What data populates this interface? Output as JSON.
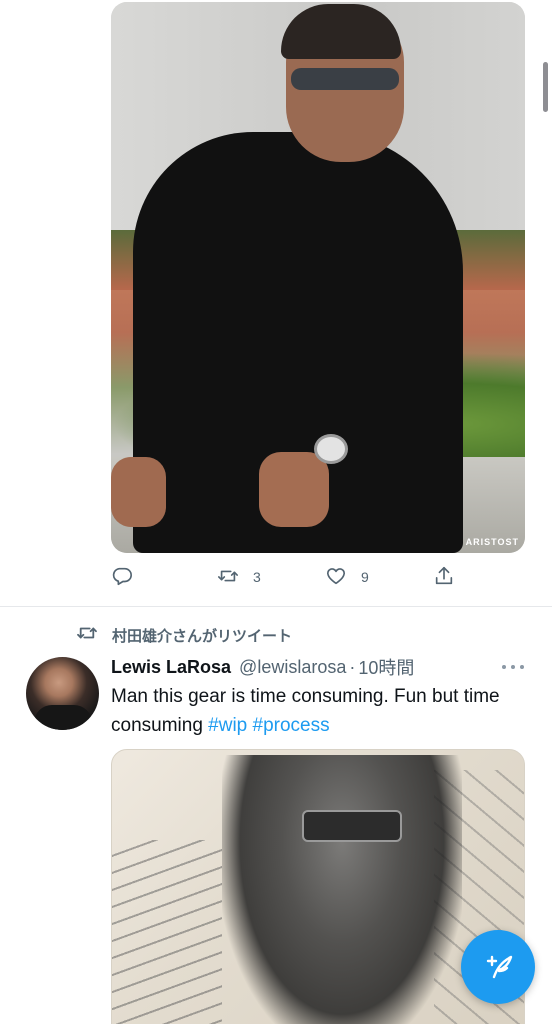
{
  "tweet1": {
    "photo_credit": "ARISTOST",
    "actions": {
      "reply_count": "",
      "retweet_count": "3",
      "like_count": "9"
    }
  },
  "tweet2": {
    "retweet_context": "村田雄介さんがリツイート",
    "author_name": "Lewis LaRosa",
    "author_handle": "@lewislarosa",
    "separator": "·",
    "time": "10時間",
    "text_plain": "Man this gear is time consuming. Fun but time consuming ",
    "hashtags": [
      "#wip",
      "#process"
    ]
  },
  "icons": {
    "reply": "reply-icon",
    "retweet": "retweet-icon",
    "like": "heart-icon",
    "share": "share-icon",
    "more": "more-icon",
    "compose": "compose-icon"
  },
  "colors": {
    "accent": "#1d9bf0",
    "secondary_text": "#536471",
    "primary_text": "#0f1419"
  }
}
